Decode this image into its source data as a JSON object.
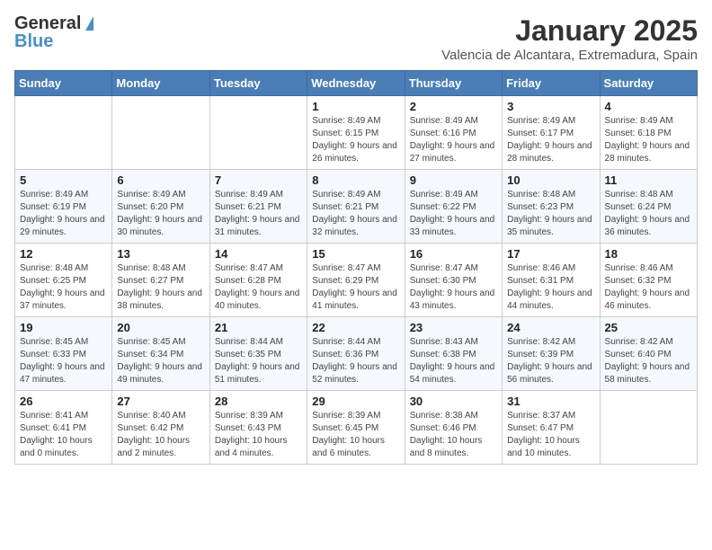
{
  "header": {
    "logo_general": "General",
    "logo_blue": "Blue",
    "month_year": "January 2025",
    "location": "Valencia de Alcantara, Extremadura, Spain"
  },
  "weekdays": [
    "Sunday",
    "Monday",
    "Tuesday",
    "Wednesday",
    "Thursday",
    "Friday",
    "Saturday"
  ],
  "weeks": [
    [
      {
        "day": "",
        "sunrise": "",
        "sunset": "",
        "daylight": ""
      },
      {
        "day": "",
        "sunrise": "",
        "sunset": "",
        "daylight": ""
      },
      {
        "day": "",
        "sunrise": "",
        "sunset": "",
        "daylight": ""
      },
      {
        "day": "1",
        "sunrise": "Sunrise: 8:49 AM",
        "sunset": "Sunset: 6:15 PM",
        "daylight": "Daylight: 9 hours and 26 minutes."
      },
      {
        "day": "2",
        "sunrise": "Sunrise: 8:49 AM",
        "sunset": "Sunset: 6:16 PM",
        "daylight": "Daylight: 9 hours and 27 minutes."
      },
      {
        "day": "3",
        "sunrise": "Sunrise: 8:49 AM",
        "sunset": "Sunset: 6:17 PM",
        "daylight": "Daylight: 9 hours and 28 minutes."
      },
      {
        "day": "4",
        "sunrise": "Sunrise: 8:49 AM",
        "sunset": "Sunset: 6:18 PM",
        "daylight": "Daylight: 9 hours and 28 minutes."
      }
    ],
    [
      {
        "day": "5",
        "sunrise": "Sunrise: 8:49 AM",
        "sunset": "Sunset: 6:19 PM",
        "daylight": "Daylight: 9 hours and 29 minutes."
      },
      {
        "day": "6",
        "sunrise": "Sunrise: 8:49 AM",
        "sunset": "Sunset: 6:20 PM",
        "daylight": "Daylight: 9 hours and 30 minutes."
      },
      {
        "day": "7",
        "sunrise": "Sunrise: 8:49 AM",
        "sunset": "Sunset: 6:21 PM",
        "daylight": "Daylight: 9 hours and 31 minutes."
      },
      {
        "day": "8",
        "sunrise": "Sunrise: 8:49 AM",
        "sunset": "Sunset: 6:21 PM",
        "daylight": "Daylight: 9 hours and 32 minutes."
      },
      {
        "day": "9",
        "sunrise": "Sunrise: 8:49 AM",
        "sunset": "Sunset: 6:22 PM",
        "daylight": "Daylight: 9 hours and 33 minutes."
      },
      {
        "day": "10",
        "sunrise": "Sunrise: 8:48 AM",
        "sunset": "Sunset: 6:23 PM",
        "daylight": "Daylight: 9 hours and 35 minutes."
      },
      {
        "day": "11",
        "sunrise": "Sunrise: 8:48 AM",
        "sunset": "Sunset: 6:24 PM",
        "daylight": "Daylight: 9 hours and 36 minutes."
      }
    ],
    [
      {
        "day": "12",
        "sunrise": "Sunrise: 8:48 AM",
        "sunset": "Sunset: 6:25 PM",
        "daylight": "Daylight: 9 hours and 37 minutes."
      },
      {
        "day": "13",
        "sunrise": "Sunrise: 8:48 AM",
        "sunset": "Sunset: 6:27 PM",
        "daylight": "Daylight: 9 hours and 38 minutes."
      },
      {
        "day": "14",
        "sunrise": "Sunrise: 8:47 AM",
        "sunset": "Sunset: 6:28 PM",
        "daylight": "Daylight: 9 hours and 40 minutes."
      },
      {
        "day": "15",
        "sunrise": "Sunrise: 8:47 AM",
        "sunset": "Sunset: 6:29 PM",
        "daylight": "Daylight: 9 hours and 41 minutes."
      },
      {
        "day": "16",
        "sunrise": "Sunrise: 8:47 AM",
        "sunset": "Sunset: 6:30 PM",
        "daylight": "Daylight: 9 hours and 43 minutes."
      },
      {
        "day": "17",
        "sunrise": "Sunrise: 8:46 AM",
        "sunset": "Sunset: 6:31 PM",
        "daylight": "Daylight: 9 hours and 44 minutes."
      },
      {
        "day": "18",
        "sunrise": "Sunrise: 8:46 AM",
        "sunset": "Sunset: 6:32 PM",
        "daylight": "Daylight: 9 hours and 46 minutes."
      }
    ],
    [
      {
        "day": "19",
        "sunrise": "Sunrise: 8:45 AM",
        "sunset": "Sunset: 6:33 PM",
        "daylight": "Daylight: 9 hours and 47 minutes."
      },
      {
        "day": "20",
        "sunrise": "Sunrise: 8:45 AM",
        "sunset": "Sunset: 6:34 PM",
        "daylight": "Daylight: 9 hours and 49 minutes."
      },
      {
        "day": "21",
        "sunrise": "Sunrise: 8:44 AM",
        "sunset": "Sunset: 6:35 PM",
        "daylight": "Daylight: 9 hours and 51 minutes."
      },
      {
        "day": "22",
        "sunrise": "Sunrise: 8:44 AM",
        "sunset": "Sunset: 6:36 PM",
        "daylight": "Daylight: 9 hours and 52 minutes."
      },
      {
        "day": "23",
        "sunrise": "Sunrise: 8:43 AM",
        "sunset": "Sunset: 6:38 PM",
        "daylight": "Daylight: 9 hours and 54 minutes."
      },
      {
        "day": "24",
        "sunrise": "Sunrise: 8:42 AM",
        "sunset": "Sunset: 6:39 PM",
        "daylight": "Daylight: 9 hours and 56 minutes."
      },
      {
        "day": "25",
        "sunrise": "Sunrise: 8:42 AM",
        "sunset": "Sunset: 6:40 PM",
        "daylight": "Daylight: 9 hours and 58 minutes."
      }
    ],
    [
      {
        "day": "26",
        "sunrise": "Sunrise: 8:41 AM",
        "sunset": "Sunset: 6:41 PM",
        "daylight": "Daylight: 10 hours and 0 minutes."
      },
      {
        "day": "27",
        "sunrise": "Sunrise: 8:40 AM",
        "sunset": "Sunset: 6:42 PM",
        "daylight": "Daylight: 10 hours and 2 minutes."
      },
      {
        "day": "28",
        "sunrise": "Sunrise: 8:39 AM",
        "sunset": "Sunset: 6:43 PM",
        "daylight": "Daylight: 10 hours and 4 minutes."
      },
      {
        "day": "29",
        "sunrise": "Sunrise: 8:39 AM",
        "sunset": "Sunset: 6:45 PM",
        "daylight": "Daylight: 10 hours and 6 minutes."
      },
      {
        "day": "30",
        "sunrise": "Sunrise: 8:38 AM",
        "sunset": "Sunset: 6:46 PM",
        "daylight": "Daylight: 10 hours and 8 minutes."
      },
      {
        "day": "31",
        "sunrise": "Sunrise: 8:37 AM",
        "sunset": "Sunset: 6:47 PM",
        "daylight": "Daylight: 10 hours and 10 minutes."
      },
      {
        "day": "",
        "sunrise": "",
        "sunset": "",
        "daylight": ""
      }
    ]
  ]
}
